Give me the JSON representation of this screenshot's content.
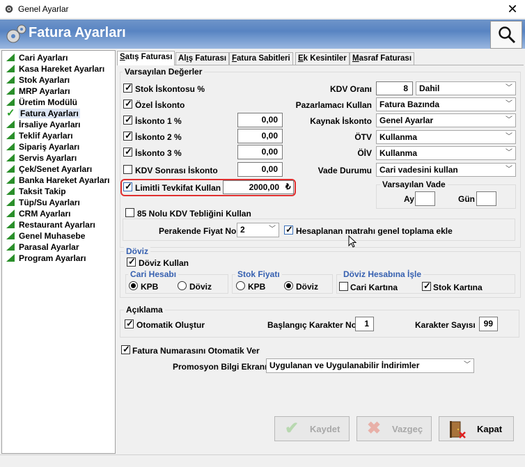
{
  "window": {
    "title": "Genel Ayarlar",
    "close": "✕"
  },
  "header": {
    "title": "Fatura Ayarları"
  },
  "tree": {
    "items": [
      {
        "label": "Cari Ayarları"
      },
      {
        "label": "Kasa Hareket Ayarları"
      },
      {
        "label": "Stok Ayarları"
      },
      {
        "label": "MRP Ayarları"
      },
      {
        "label": "Üretim Modülü"
      },
      {
        "label": "Fatura Ayarları",
        "selected": true
      },
      {
        "label": "İrsaliye Ayarları"
      },
      {
        "label": "Teklif Ayarları"
      },
      {
        "label": "Sipariş Ayarları"
      },
      {
        "label": "Servis Ayarları"
      },
      {
        "label": "Çek/Senet Ayarları"
      },
      {
        "label": "Banka Hareket Ayarları"
      },
      {
        "label": "Taksit Takip"
      },
      {
        "label": "Tüp/Su Ayarları"
      },
      {
        "label": "CRM Ayarları"
      },
      {
        "label": "Restaurant Ayarları"
      },
      {
        "label": "Genel Muhasebe"
      },
      {
        "label": "Parasal Ayarlar"
      },
      {
        "label": "Program Ayarları"
      }
    ]
  },
  "tabs": [
    {
      "u": "S",
      "rest": "atış Faturası"
    },
    {
      "pre": "Al",
      "u": "ı",
      "rest": "ş Faturası"
    },
    {
      "u": "F",
      "rest": "atura Sabitleri"
    },
    {
      "u": "E",
      "rest": "k Kesintiler"
    },
    {
      "u": "M",
      "rest": "asraf Faturası"
    }
  ],
  "defaults": {
    "group_title": "Varsayılan Değerler",
    "stok_iskontosu": "Stok İskontosu %",
    "ozel_iskonto": "Özel İskonto",
    "iskonto1": "İskonto 1 %",
    "iskonto1_val": "0,00",
    "iskonto2": "İskonto 2 %",
    "iskonto2_val": "0,00",
    "iskonto3": "İskonto 3 %",
    "iskonto3_val": "0,00",
    "kdv_sonrasi": "KDV Sonrası İskonto",
    "kdv_sonrasi_val": "0,00",
    "limitli": "Limitli Tevkifat Kullan",
    "limitli_val": "2000,00",
    "currency": "₺",
    "kdv_orani": "KDV Oranı",
    "kdv_orani_val": "8",
    "kdv_dahil": "Dahil",
    "pazarlamaci": "Pazarlamacı Kullan",
    "pazarlamaci_val": "Fatura Bazında",
    "kaynak": "Kaynak İskonto",
    "kaynak_val": "Genel Ayarlar",
    "otv": "ÖTV",
    "otv_val": "Kullanma",
    "oiv": "ÖİV",
    "oiv_val": "Kullanma",
    "vade_durumu": "Vade Durumu",
    "vade_durumu_val": "Cari vadesini kullan",
    "varsayilan_vade": "Varsayılan Vade",
    "ay": "Ay",
    "gun": "Gün",
    "kdv85": "85 Nolu KDV Tebliğini Kullan",
    "perakende": "Perakende Fiyat No",
    "perakende_val": "2",
    "hesaplanan": "Hesaplanan matrahı genel toplama ekle"
  },
  "doviz": {
    "title": "Döviz",
    "kullan": "Döviz Kullan",
    "cari_hesabi": "Cari Hesabı",
    "stok_fiyati": "Stok Fiyatı",
    "doviz_hesabina": "Döviz Hesabına İşle",
    "kpb": "KPB",
    "doviz": "Döviz",
    "cari_karti": "Cari Kartına",
    "stok_karti": "Stok Kartına"
  },
  "aciklama": {
    "title": "Açıklama",
    "otomatik": "Otomatik Oluştur",
    "baslangic": "Başlangıç Karakter No",
    "baslangic_val": "1",
    "sayisi": "Karakter Sayısı",
    "sayisi_val": "99"
  },
  "fatura_no": "Fatura Numarasını Otomatik Ver",
  "promosyon": "Promosyon Bilgi Ekranı",
  "promosyon_val": "Uygulanan ve Uygulanabilir İndirimler",
  "buttons": {
    "kaydet": "Kaydet",
    "vazgec": "Vazgeç",
    "kapat": "Kapat"
  },
  "colors": {
    "header": "#5884c2",
    "highlight": "#e03030",
    "tree_icon": "#2a8f2a"
  }
}
